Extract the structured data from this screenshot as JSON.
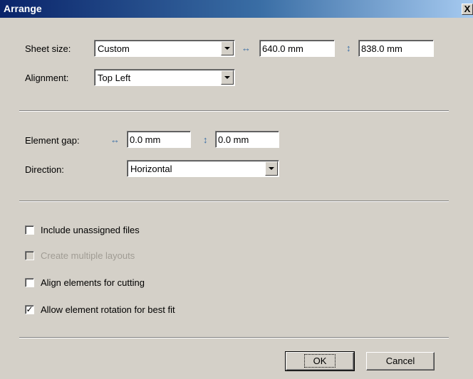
{
  "window": {
    "title": "Arrange",
    "close_glyph": "X"
  },
  "sheet": {
    "size_label": "Sheet size:",
    "size_value": "Custom",
    "width_icon": "horizontal-arrows-icon",
    "width_value": "640.0 mm",
    "height_icon": "vertical-arrows-icon",
    "height_value": "838.0 mm",
    "alignment_label": "Alignment:",
    "alignment_value": "Top Left"
  },
  "gap": {
    "label": "Element gap:",
    "horizontal_value": "0.0 mm",
    "vertical_value": "0.0 mm",
    "direction_label": "Direction:",
    "direction_value": "Horizontal"
  },
  "options": [
    {
      "label": "Include unassigned files",
      "checked": false,
      "enabled": true
    },
    {
      "label": "Create multiple layouts",
      "checked": false,
      "enabled": false
    },
    {
      "label": "Align elements for cutting",
      "checked": false,
      "enabled": true
    },
    {
      "label": "Allow element rotation for best fit",
      "checked": true,
      "enabled": true
    }
  ],
  "buttons": {
    "ok": "OK",
    "cancel": "Cancel"
  },
  "colors": {
    "titlebar": "#0a246a",
    "face": "#d4d0c8",
    "icon_accent": "#3a6ea5"
  }
}
